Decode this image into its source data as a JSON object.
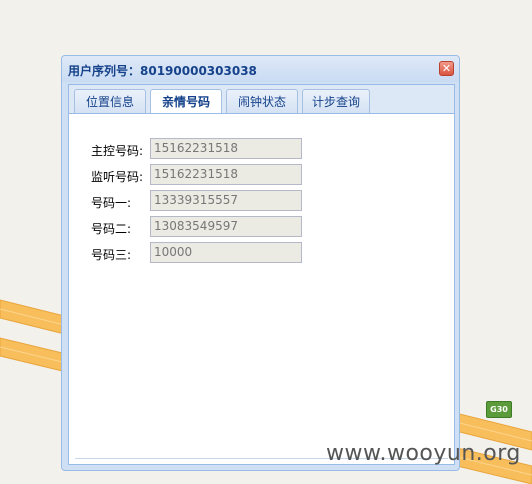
{
  "dialog": {
    "title": "用户序列号：80190000303038",
    "close_glyph": "✕"
  },
  "tabs": [
    {
      "label": "位置信息",
      "active": false
    },
    {
      "label": "亲情号码",
      "active": true
    },
    {
      "label": "闹钟状态",
      "active": false
    },
    {
      "label": "计步查询",
      "active": false
    }
  ],
  "form": {
    "rows": [
      {
        "label": "主控号码:",
        "value": "15162231518"
      },
      {
        "label": "监听号码:",
        "value": "15162231518"
      },
      {
        "label": "号码一:",
        "value": "13339315557"
      },
      {
        "label": "号码二:",
        "value": "13083549597"
      },
      {
        "label": "号码三:",
        "value": "10000"
      }
    ]
  },
  "map": {
    "road_badge": "G30",
    "road_color": "#f8be5b",
    "badge_color": "#5c9b3a"
  },
  "watermark": "www.wooyun.org"
}
